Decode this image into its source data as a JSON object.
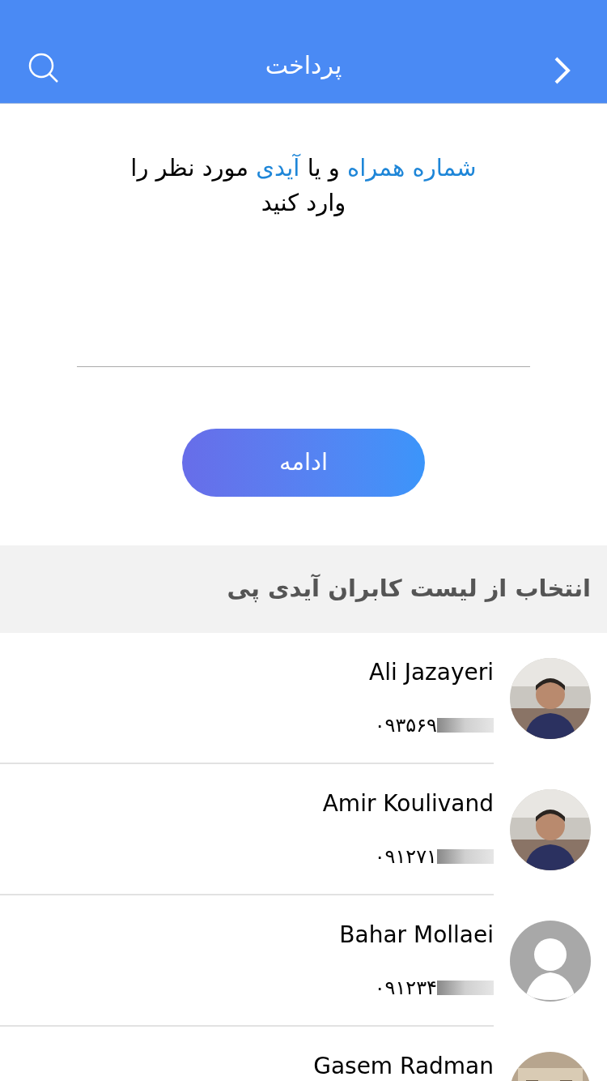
{
  "header": {
    "title": "پرداخت"
  },
  "instruction": [
    {
      "text": "شماره همراه",
      "kind": "highlight"
    },
    {
      "text": " و یا ",
      "kind": "plain"
    },
    {
      "text": "آیدی",
      "kind": "highlight"
    },
    {
      "text": " مورد نظر را وارد کنید",
      "kind": "plain"
    }
  ],
  "continue_button": {
    "label": "ادامه"
  },
  "section": {
    "title": "انتخاب از لیست کابران آیدی پی"
  },
  "contacts": [
    {
      "name": "Ali Jazayeri",
      "phone": "۰۹۳۵۶۹",
      "redacted": true,
      "kind": "picture"
    },
    {
      "name": "Amir Koulivand",
      "phone": "۰۹۱۲۷۱",
      "redacted": true,
      "kind": "picture"
    },
    {
      "name": "Bahar Mollaei",
      "phone": "۰۹۱۲۳۴",
      "redacted": true,
      "kind": "placeholder"
    },
    {
      "name": "Gasem Radman",
      "kind": "picture"
    }
  ]
}
